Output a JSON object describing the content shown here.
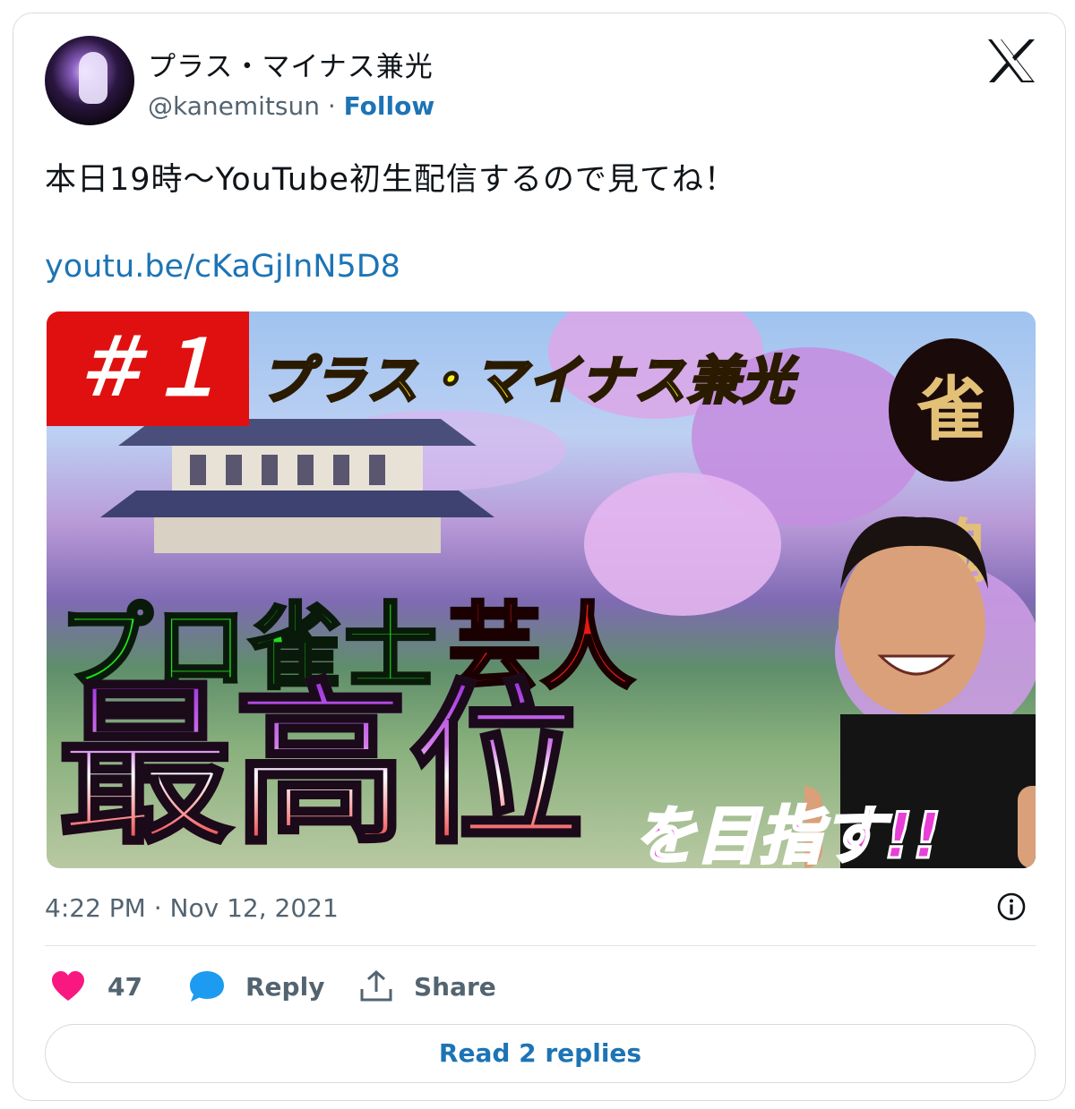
{
  "author": {
    "display_name": "プラス・マイナス兼光",
    "handle": "@kanemitsun",
    "separator": " · ",
    "follow_label": "Follow"
  },
  "tweet": {
    "text": "本日19時〜YouTube初生配信するので見てね！",
    "link": "youtu.be/cKaGjInN5D8"
  },
  "thumbnail": {
    "episode": "＃１",
    "name": "プラス・マイナス兼光",
    "logo_text": "雀魂",
    "line1_green": "プロ雀士",
    "line1_red": "芸人",
    "big_word": "最高位",
    "goal": "を目指す!!"
  },
  "meta": {
    "timestamp": "4:22 PM · Nov 12, 2021"
  },
  "actions": {
    "like_count": "47",
    "reply_label": "Reply",
    "share_label": "Share",
    "read_replies_label": "Read 2 replies"
  },
  "colors": {
    "link": "#1d74b5",
    "like": "#f91880",
    "reply": "#1d9bf0",
    "muted": "#536471"
  },
  "icons": [
    "x-logo-icon",
    "heart-icon",
    "reply-bubble-icon",
    "share-icon",
    "info-icon"
  ]
}
